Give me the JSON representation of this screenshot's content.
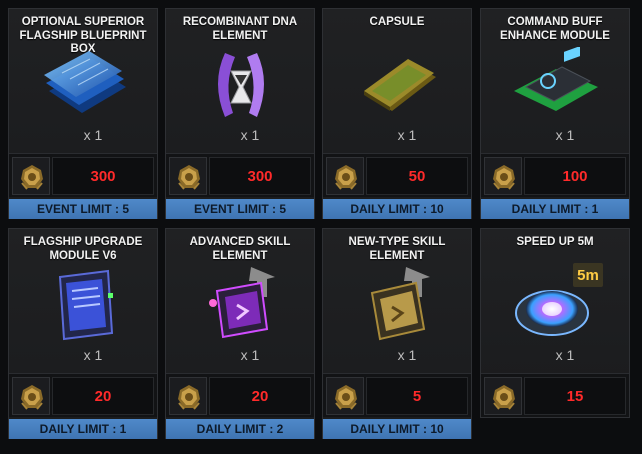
{
  "items": [
    {
      "title": "OPTIONAL SUPERIOR FLAGSHIP BLUEPRINT BOX",
      "qty": "x 1",
      "price": "300",
      "limit": "EVENT LIMIT : 5",
      "icon": "blueprint-box-icon"
    },
    {
      "title": "RECOMBINANT DNA ELEMENT",
      "qty": "x 1",
      "price": "300",
      "limit": "EVENT LIMIT : 5",
      "icon": "dna-element-icon"
    },
    {
      "title": "CAPSULE",
      "qty": "x 1",
      "price": "50",
      "limit": "DAILY LIMIT : 10",
      "icon": "capsule-icon"
    },
    {
      "title": "COMMAND BUFF ENHANCE MODULE",
      "qty": "x 1",
      "price": "100",
      "limit": "DAILY LIMIT : 1",
      "icon": "command-module-icon"
    },
    {
      "title": "FLAGSHIP UPGRADE MODULE V6",
      "qty": "x 1",
      "price": "20",
      "limit": "DAILY LIMIT : 1",
      "icon": "upgrade-module-icon"
    },
    {
      "title": "ADVANCED SKILL ELEMENT",
      "qty": "x 1",
      "price": "20",
      "limit": "DAILY LIMIT : 2",
      "icon": "advanced-skill-icon"
    },
    {
      "title": "NEW-TYPE SKILL ELEMENT",
      "qty": "x 1",
      "price": "5",
      "limit": "DAILY LIMIT : 10",
      "icon": "newtype-skill-icon"
    },
    {
      "title": "SPEED UP 5M",
      "qty": "x 1",
      "price": "15",
      "limit": "",
      "badge": "5m",
      "icon": "speedup-icon"
    }
  ],
  "currency_icon": "gold-alloy-currency-icon",
  "colors": {
    "price": "#ff2a2a",
    "limit_bar": "#4f89c9",
    "card_bg": "#1f2022"
  }
}
